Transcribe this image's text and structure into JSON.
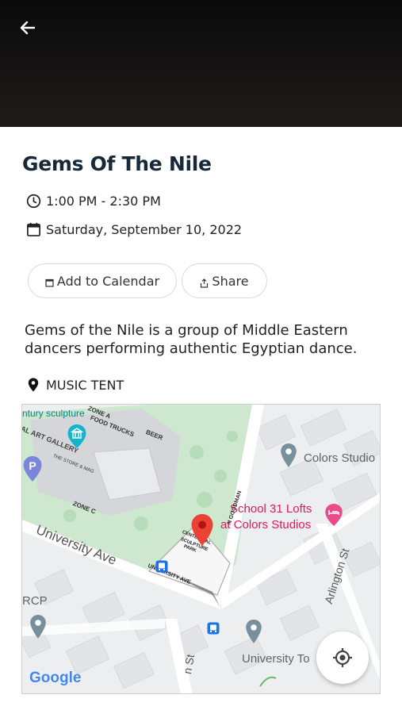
{
  "header": {
    "back_icon": "arrow-left-icon"
  },
  "event": {
    "title": "Gems Of The Nile",
    "time": "1:00 PM - 2:30 PM",
    "date": "Saturday, September 10, 2022",
    "description": "Gems of the Nile is a group of Middle Eastern dancers performing authentic Egyptian dance.",
    "location": "MUSIC TENT"
  },
  "actions": {
    "add_to_calendar": "Add to Calendar",
    "share": "Share"
  },
  "map": {
    "labels": {
      "century_sculpture": "ntury sculpture",
      "art_gallery": "IAL ART GALLERY",
      "food_trucks": "FOOD TRUCKS",
      "beer": "BEER",
      "zone_a": "ZONE A",
      "zone_c": "ZONE C",
      "store": "THE STORE & MAG",
      "colors_studio": "Colors Studio",
      "school_lofts_1": "School 31 Lofts",
      "school_lofts_2": "at Colors Studios",
      "university_ave": "University Ave",
      "university_ave_small": "UNIVERSITY AVE",
      "centennial_1": "CENTENNIAL",
      "centennial_2": "SCULPTURE",
      "centennial_3": "PARK",
      "n_goodman": "N GOODMAN",
      "arlington": "Arlington St",
      "rcp": "RCP",
      "university_to": "University To",
      "n_st": "n St",
      "google": "Google"
    },
    "colors": {
      "park": "#c8e6c9",
      "road": "#ffffff",
      "pin": "#ea4335",
      "poi": "#e91e63",
      "transit": "#1a73e8"
    },
    "icons": [
      "location-pin-icon",
      "parking-icon",
      "museum-icon",
      "bus-stop-icon",
      "hotel-icon",
      "my-location-icon"
    ]
  }
}
